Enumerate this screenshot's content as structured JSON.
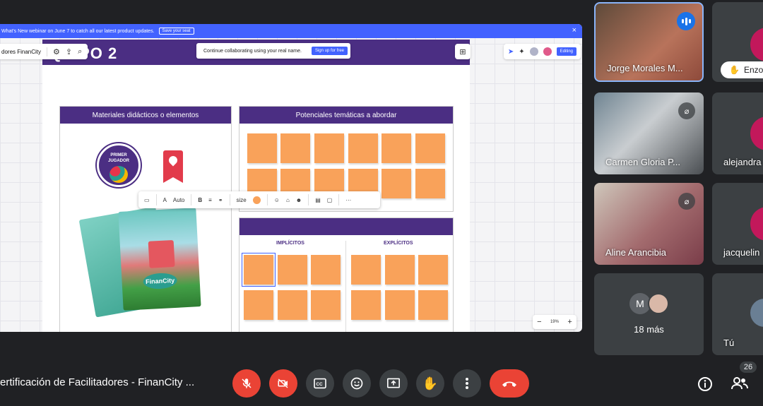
{
  "shared_screen": {
    "webinar_banner": {
      "text": "What's New webinar on June 7 to catch all our latest product updates.",
      "button": "Save your seat",
      "close": "×"
    },
    "board_name": "dores FinanCity",
    "board_header": "QUIPO 2",
    "collab_prompt": "Continue collaborating using your real name.",
    "signup": "Sign up for free",
    "editing": "Editing",
    "panels": {
      "materials": "Materiales didácticos o elementos",
      "topics": "Potenciales temáticas a abordar"
    },
    "columns": {
      "implicit": "IMPLÍCITOS",
      "explicit": "EXPLÍCITOS"
    },
    "badge_text": "PRIMER JUGADOR",
    "badge_city": "FinanCity",
    "toolbar": {
      "font": "Auto",
      "size": "size",
      "more": "···"
    },
    "zoom": {
      "level": "19%",
      "minus": "−",
      "plus": "+"
    },
    "colors": {
      "header": "#4b2e83",
      "sticky": "#f9a25a",
      "accent": "#4262ff"
    }
  },
  "participants": [
    {
      "name": "Jorge Morales M...",
      "state": "speaking"
    },
    {
      "name": "Enzo"
    },
    {
      "name": "Carmen Gloria P...",
      "state": "muted"
    },
    {
      "name": "alejandra"
    },
    {
      "name": "Aline Arancibia",
      "state": "muted"
    },
    {
      "name": "jacquelin"
    },
    {
      "name": "18 más",
      "avatar_initial": "M"
    },
    {
      "name": "Tú"
    }
  ],
  "meeting": {
    "title": "ertificación de Facilitadores - FinanCity ...",
    "participant_count": "26"
  }
}
